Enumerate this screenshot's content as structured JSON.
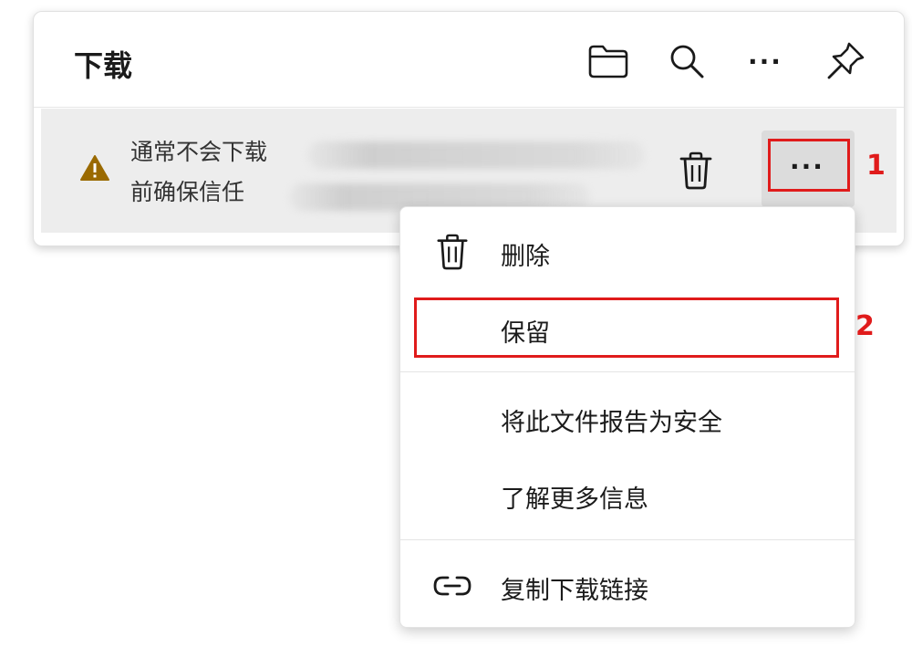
{
  "panel": {
    "title": "下载",
    "header_icons": [
      "folder-icon",
      "search-icon",
      "more-icon",
      "pin-icon"
    ],
    "more_glyph": "···"
  },
  "download_item": {
    "line1": "通常不会下载",
    "line2": "前确保信任",
    "status_icon": "warning-icon",
    "warning_color": "#9a6a00",
    "more_glyph": "···"
  },
  "menu": {
    "items": [
      {
        "label": "删除",
        "icon": "trash-icon"
      },
      {
        "label": "保留",
        "icon": ""
      },
      {
        "label": "将此文件报告为安全",
        "icon": ""
      },
      {
        "label": "了解更多信息",
        "icon": ""
      },
      {
        "label": "复制下载链接",
        "icon": "link-icon"
      }
    ]
  },
  "annotations": {
    "step1": "1",
    "step2": "2",
    "color": "#e01b1b"
  }
}
